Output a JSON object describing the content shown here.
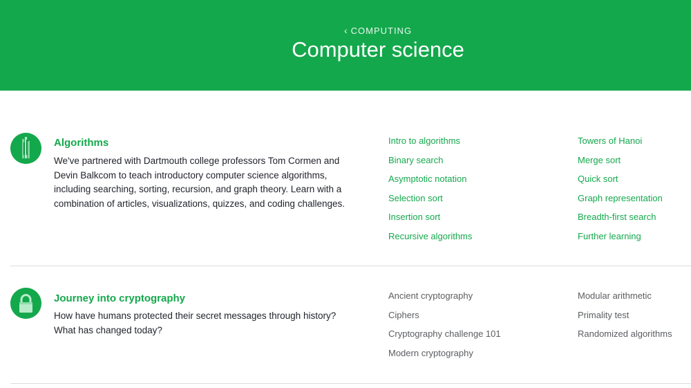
{
  "header": {
    "breadcrumb": "COMPUTING",
    "title": "Computer science"
  },
  "sections": [
    {
      "title": "Algorithms",
      "description": "We've partnered with Dartmouth college professors Tom Cormen and Devin Balkcom to teach introductory computer science algorithms, including searching, sorting, recursion, and graph theory. Learn with a combination of articles, visualizations, quizzes, and coding challenges.",
      "icon": "algorithms-icon",
      "col1": [
        "Intro to algorithms",
        "Binary search",
        "Asymptotic notation",
        "Selection sort",
        "Insertion sort",
        "Recursive algorithms"
      ],
      "col2": [
        "Towers of Hanoi",
        "Merge sort",
        "Quick sort",
        "Graph representation",
        "Breadth-first search",
        "Further learning"
      ]
    },
    {
      "title": "Journey into cryptography",
      "description": "How have humans protected their secret messages through history? What has changed today?",
      "icon": "lock-icon",
      "col1": [
        "Ancient cryptography",
        "Ciphers",
        "Cryptography challenge 101",
        "Modern cryptography"
      ],
      "col2": [
        "Modular arithmetic",
        "Primality test",
        "Randomized algorithms"
      ]
    }
  ],
  "colors": {
    "brand_green": "#14a84c",
    "link_green": "#14a84c",
    "link_gray": "#5b5d61"
  }
}
